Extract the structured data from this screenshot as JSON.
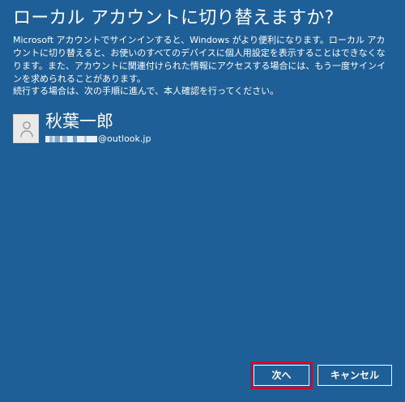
{
  "title": "ローカル アカウントに切り替えますか?",
  "description": "Microsoft アカウントでサインインすると、Windows がより便利になります。ローカル アカウントに切り替えると、お使いのすべてのデバイスに個人用設定を表示することはできなくなります。また、アカウントに関連付けられた情報にアクセスする場合には、もう一度サインインを求められることがあります。",
  "continue_text": "続行する場合は、次の手順に進んで、本人確認を行ってください。",
  "account": {
    "name": "秋葉一郎",
    "email_suffix": "@outlook.jp",
    "icon": "user-avatar-icon"
  },
  "buttons": {
    "next": "次へ",
    "cancel": "キャンセル"
  },
  "colors": {
    "background": "#1f5f97",
    "text": "#ffffff",
    "highlight": "#e00024"
  }
}
